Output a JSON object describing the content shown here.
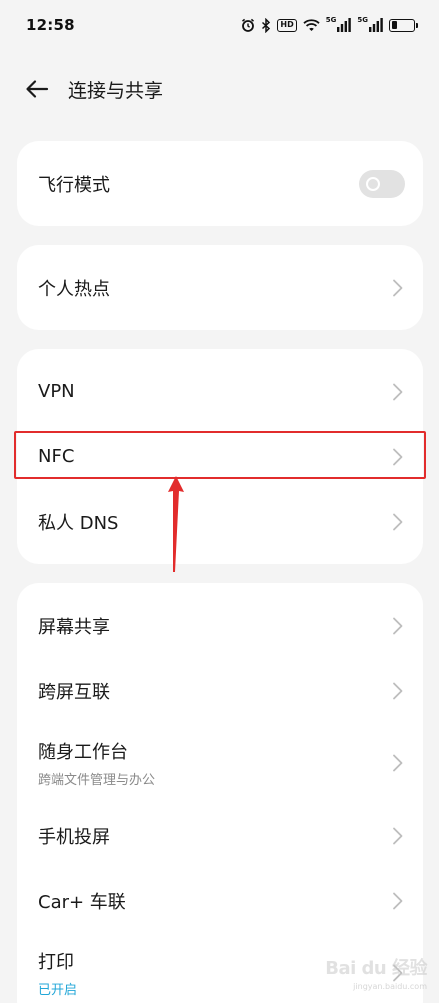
{
  "status_bar": {
    "time": "12:58",
    "hd_label": "HD",
    "net1_label": "5G",
    "net2_label": "5G",
    "battery_level": 0.25
  },
  "header": {
    "title": "连接与共享",
    "back_icon": "arrow-left-icon"
  },
  "sections": {
    "airplane": {
      "label": "飞行模式",
      "toggle_on": false
    },
    "hotspot": {
      "label": "个人热点"
    },
    "vpn": {
      "label": "VPN"
    },
    "nfc": {
      "label": "NFC"
    },
    "private_dns": {
      "label": "私人 DNS"
    },
    "screen_share": {
      "label": "屏幕共享"
    },
    "cross_screen": {
      "label": "跨屏互联"
    },
    "workstation": {
      "label": "随身工作台",
      "sub": "跨端文件管理与办公"
    },
    "cast": {
      "label": "手机投屏"
    },
    "carplus": {
      "label": "Car+ 车联"
    },
    "print": {
      "label": "打印",
      "sub": "已开启"
    }
  },
  "annotation": {
    "color": "#e22c2c"
  },
  "colors": {
    "accent": "#23a7d8",
    "card": "#ffffff",
    "background": "#f4f4f4"
  },
  "watermark": {
    "main": "Bai du 经验",
    "url": "jingyan.baidu.com"
  }
}
